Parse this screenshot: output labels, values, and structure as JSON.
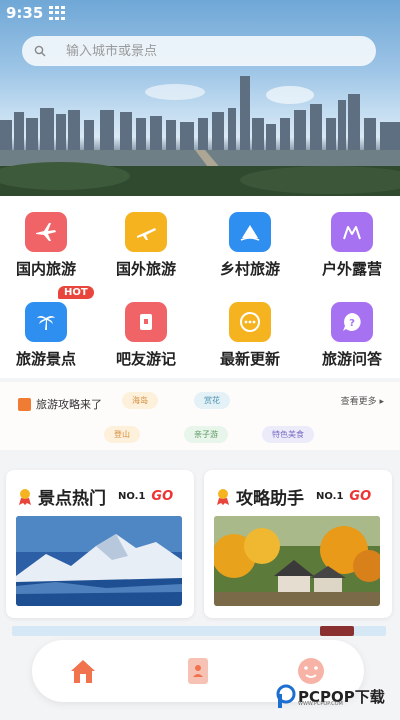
{
  "status_bar": {
    "time": "9:35"
  },
  "search": {
    "placeholder": "输入城市或景点"
  },
  "categories": [
    {
      "label": "国内旅游",
      "icon": "airplane-icon",
      "color": "#f06468"
    },
    {
      "label": "国外旅游",
      "icon": "plane-takeoff-icon",
      "color": "#f6b320"
    },
    {
      "label": "乡村旅游",
      "icon": "mountain-sail-icon",
      "color": "#2f8ff0"
    },
    {
      "label": "户外露营",
      "icon": "tent-icon",
      "color": "#a672f2"
    },
    {
      "label": "旅游景点",
      "icon": "palm-tree-icon",
      "color": "#2f8ff0",
      "badge": "HOT"
    },
    {
      "label": "吧友游记",
      "icon": "notebook-icon",
      "color": "#f06468"
    },
    {
      "label": "最新更新",
      "icon": "chat-dots-icon",
      "color": "#f6b320"
    },
    {
      "label": "旅游问答",
      "icon": "question-bubble-icon",
      "color": "#a672f2"
    }
  ],
  "news": {
    "title": "旅游攻略来了",
    "more": "查看更多 ▸",
    "tags": [
      "海岛",
      "赏花",
      "登山",
      "亲子游",
      "特色美食"
    ]
  },
  "cards": [
    {
      "title": "景点热门",
      "badge_no": "NO.1",
      "badge_go": "GO",
      "image": "snow-mountain-photo"
    },
    {
      "title": "攻略助手",
      "badge_no": "NO.1",
      "badge_go": "GO",
      "image": "autumn-village-photo"
    }
  ],
  "bottom_nav": [
    {
      "icon": "home-icon"
    },
    {
      "icon": "journal-icon"
    },
    {
      "icon": "profile-face-icon"
    }
  ],
  "watermark": {
    "text": "PCPOP下载",
    "sub": "WWW.PCPOP.COM"
  },
  "colors": {
    "accent": "#f0734e",
    "hot_badge": "#e8453c",
    "go_red": "#e33333"
  }
}
